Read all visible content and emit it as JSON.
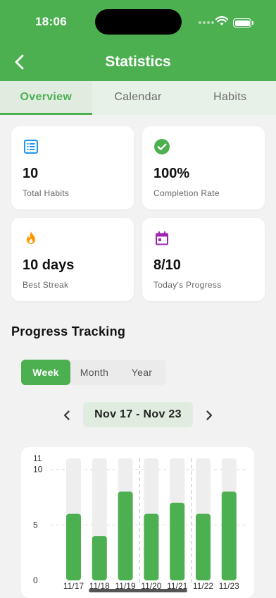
{
  "status_bar": {
    "time": "18:06"
  },
  "header": {
    "title": "Statistics"
  },
  "tabs": [
    {
      "label": "Overview",
      "active": true
    },
    {
      "label": "Calendar",
      "active": false
    },
    {
      "label": "Habits",
      "active": false
    }
  ],
  "cards": [
    {
      "icon": "list-icon",
      "value": "10",
      "label": "Total Habits",
      "color": "#2196f3"
    },
    {
      "icon": "check-circle-icon",
      "value": "100%",
      "label": "Completion Rate",
      "color": "#4caf50"
    },
    {
      "icon": "fire-icon",
      "value": "10 days",
      "label": "Best Streak",
      "color": "#ff9800"
    },
    {
      "icon": "calendar-icon",
      "value": "8/10",
      "label": "Today's Progress",
      "color": "#9c27b0"
    }
  ],
  "progress": {
    "title": "Progress Tracking",
    "periods": [
      {
        "label": "Week",
        "active": true
      },
      {
        "label": "Month",
        "active": false
      },
      {
        "label": "Year",
        "active": false
      }
    ],
    "date_range": "Nov 17 - Nov 23"
  },
  "colors": {
    "accent": "#4caf50",
    "bar_background": "#eeeeee"
  },
  "chart_data": {
    "type": "bar",
    "categories": [
      "11/17",
      "11/18",
      "11/19",
      "11/20",
      "11/21",
      "11/22",
      "11/23"
    ],
    "values": [
      6,
      4,
      8,
      6,
      7,
      6,
      8
    ],
    "background_max": 11,
    "ylim": [
      0,
      11
    ],
    "yticks": [
      "0",
      "5",
      "10",
      "11"
    ],
    "grid": true,
    "title": "",
    "xlabel": "",
    "ylabel": ""
  }
}
